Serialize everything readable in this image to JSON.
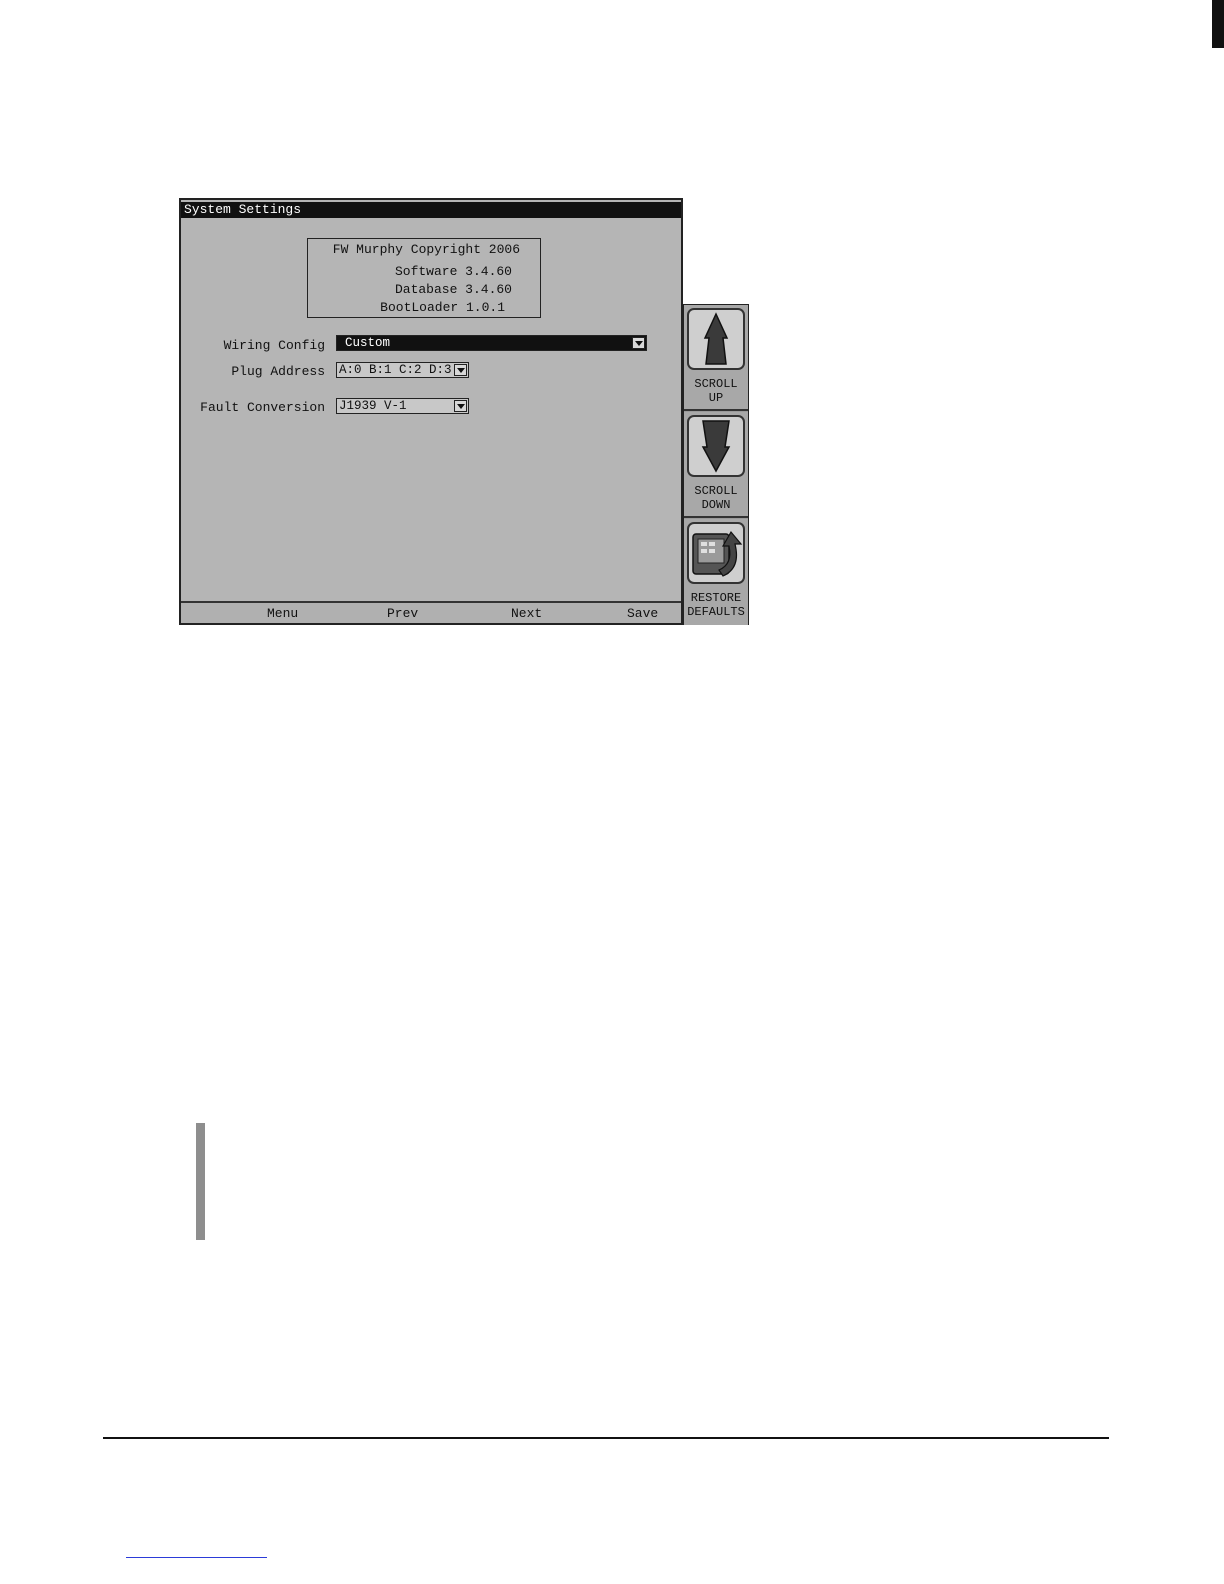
{
  "window": {
    "title": "System Settings"
  },
  "info": {
    "copyright": "FW Murphy Copyright 2006",
    "software": "Software 3.4.60",
    "database": "Database 3.4.60",
    "bootloader": "BootLoader 1.0.1"
  },
  "settings": {
    "wiring_config": {
      "label": "Wiring Config",
      "value": "Custom"
    },
    "plug_address": {
      "label": "Plug Address",
      "value": "A:0 B:1 C:2 D:3"
    },
    "fault_conversion": {
      "label": "Fault Conversion",
      "value": "J1939 V-1"
    }
  },
  "softkeys": {
    "menu": "Menu",
    "prev": "Prev",
    "next": "Next",
    "save": "Save"
  },
  "side_buttons": {
    "scroll_up": {
      "line1": "SCROLL",
      "line2": "UP",
      "icon": "arrow-up-icon"
    },
    "scroll_down": {
      "line1": "SCROLL",
      "line2": "DOWN",
      "icon": "arrow-down-icon"
    },
    "restore_defaults": {
      "line1": "RESTORE",
      "line2": "DEFAULTS",
      "icon": "restore-device-icon"
    }
  }
}
